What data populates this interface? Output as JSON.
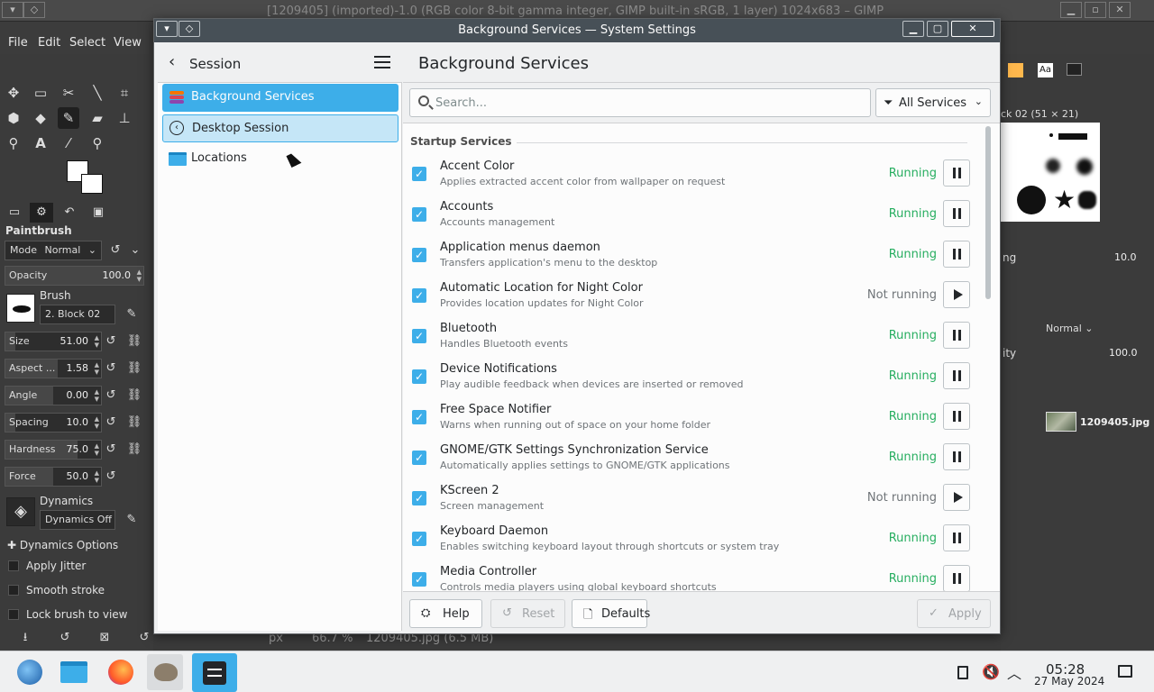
{
  "gimp": {
    "title": "[1209405] (imported)-1.0 (RGB color 8-bit gamma integer, GIMP built-in sRGB, 1 layer) 1024x683 – GIMP",
    "menu": [
      "File",
      "Edit",
      "Select",
      "View"
    ],
    "tool_options_title": "Paintbrush",
    "mode_label": "Mode",
    "mode_value": "Normal",
    "opacity_label": "Opacity",
    "opacity_value": "100.0",
    "brush_label": "Brush",
    "brush_value": "2. Block 02",
    "sliders": [
      {
        "label": "Size",
        "value": "51.00",
        "fill": 0.1
      },
      {
        "label": "Aspect ...",
        "value": "1.58",
        "fill": 0.55
      },
      {
        "label": "Angle",
        "value": "0.00",
        "fill": 0.5
      },
      {
        "label": "Spacing",
        "value": "10.0",
        "fill": 0.1
      },
      {
        "label": "Hardness",
        "value": "75.0",
        "fill": 0.75
      },
      {
        "label": "Force",
        "value": "50.0",
        "fill": 0.5
      }
    ],
    "dynamics_label": "Dynamics",
    "dynamics_value": "Dynamics Off",
    "dynamics_options": "Dynamics Options",
    "checks": [
      "Apply Jitter",
      "Smooth stroke",
      "Lock brush to view"
    ],
    "brush_panel_title": "ck 02 (51 × 21)",
    "spacing_right_label": "ng",
    "spacing_right_value": "10.0",
    "layers_mode": "Normal",
    "layers_opacity_label": "ity",
    "layers_opacity_value": "100.0",
    "layer_name": "1209405.jpg",
    "status_unit": "px",
    "status_zoom": "66.7 %",
    "status_file": "1209405.jpg (6.5 MB)"
  },
  "window": {
    "title": "Background Services — System Settings"
  },
  "sidebar": {
    "title": "Session",
    "items": [
      {
        "label": "Background Services"
      },
      {
        "label": "Desktop Session"
      },
      {
        "label": "Locations"
      }
    ]
  },
  "main": {
    "title": "Background Services",
    "search_placeholder": "Search...",
    "filter_label": "All Services",
    "section_header": "Startup Services",
    "services": [
      {
        "name": "Accent Color",
        "desc": "Applies extracted accent color from wallpaper on request",
        "status": "Running",
        "running": true
      },
      {
        "name": "Accounts",
        "desc": "Accounts management",
        "status": "Running",
        "running": true
      },
      {
        "name": "Application menus daemon",
        "desc": "Transfers application's menu to the desktop",
        "status": "Running",
        "running": true
      },
      {
        "name": "Automatic Location for Night Color",
        "desc": "Provides location updates for Night Color",
        "status": "Not running",
        "running": false
      },
      {
        "name": "Bluetooth",
        "desc": "Handles Bluetooth events",
        "status": "Running",
        "running": true
      },
      {
        "name": "Device Notifications",
        "desc": "Play audible feedback when devices are inserted or removed",
        "status": "Running",
        "running": true
      },
      {
        "name": "Free Space Notifier",
        "desc": "Warns when running out of space on your home folder",
        "status": "Running",
        "running": true
      },
      {
        "name": "GNOME/GTK Settings Synchronization Service",
        "desc": "Automatically applies settings to GNOME/GTK applications",
        "status": "Running",
        "running": true
      },
      {
        "name": "KScreen 2",
        "desc": "Screen management",
        "status": "Not running",
        "running": false
      },
      {
        "name": "Keyboard Daemon",
        "desc": "Enables switching keyboard layout through shortcuts or system tray",
        "status": "Running",
        "running": true
      },
      {
        "name": "Media Controller",
        "desc": "Controls media players using global keyboard shortcuts",
        "status": "Running",
        "running": true
      }
    ],
    "footer": {
      "help": "Help",
      "reset": "Reset",
      "defaults": "Defaults",
      "apply": "Apply"
    }
  },
  "taskbar": {
    "time": "05:28",
    "date": "27 May 2024"
  }
}
